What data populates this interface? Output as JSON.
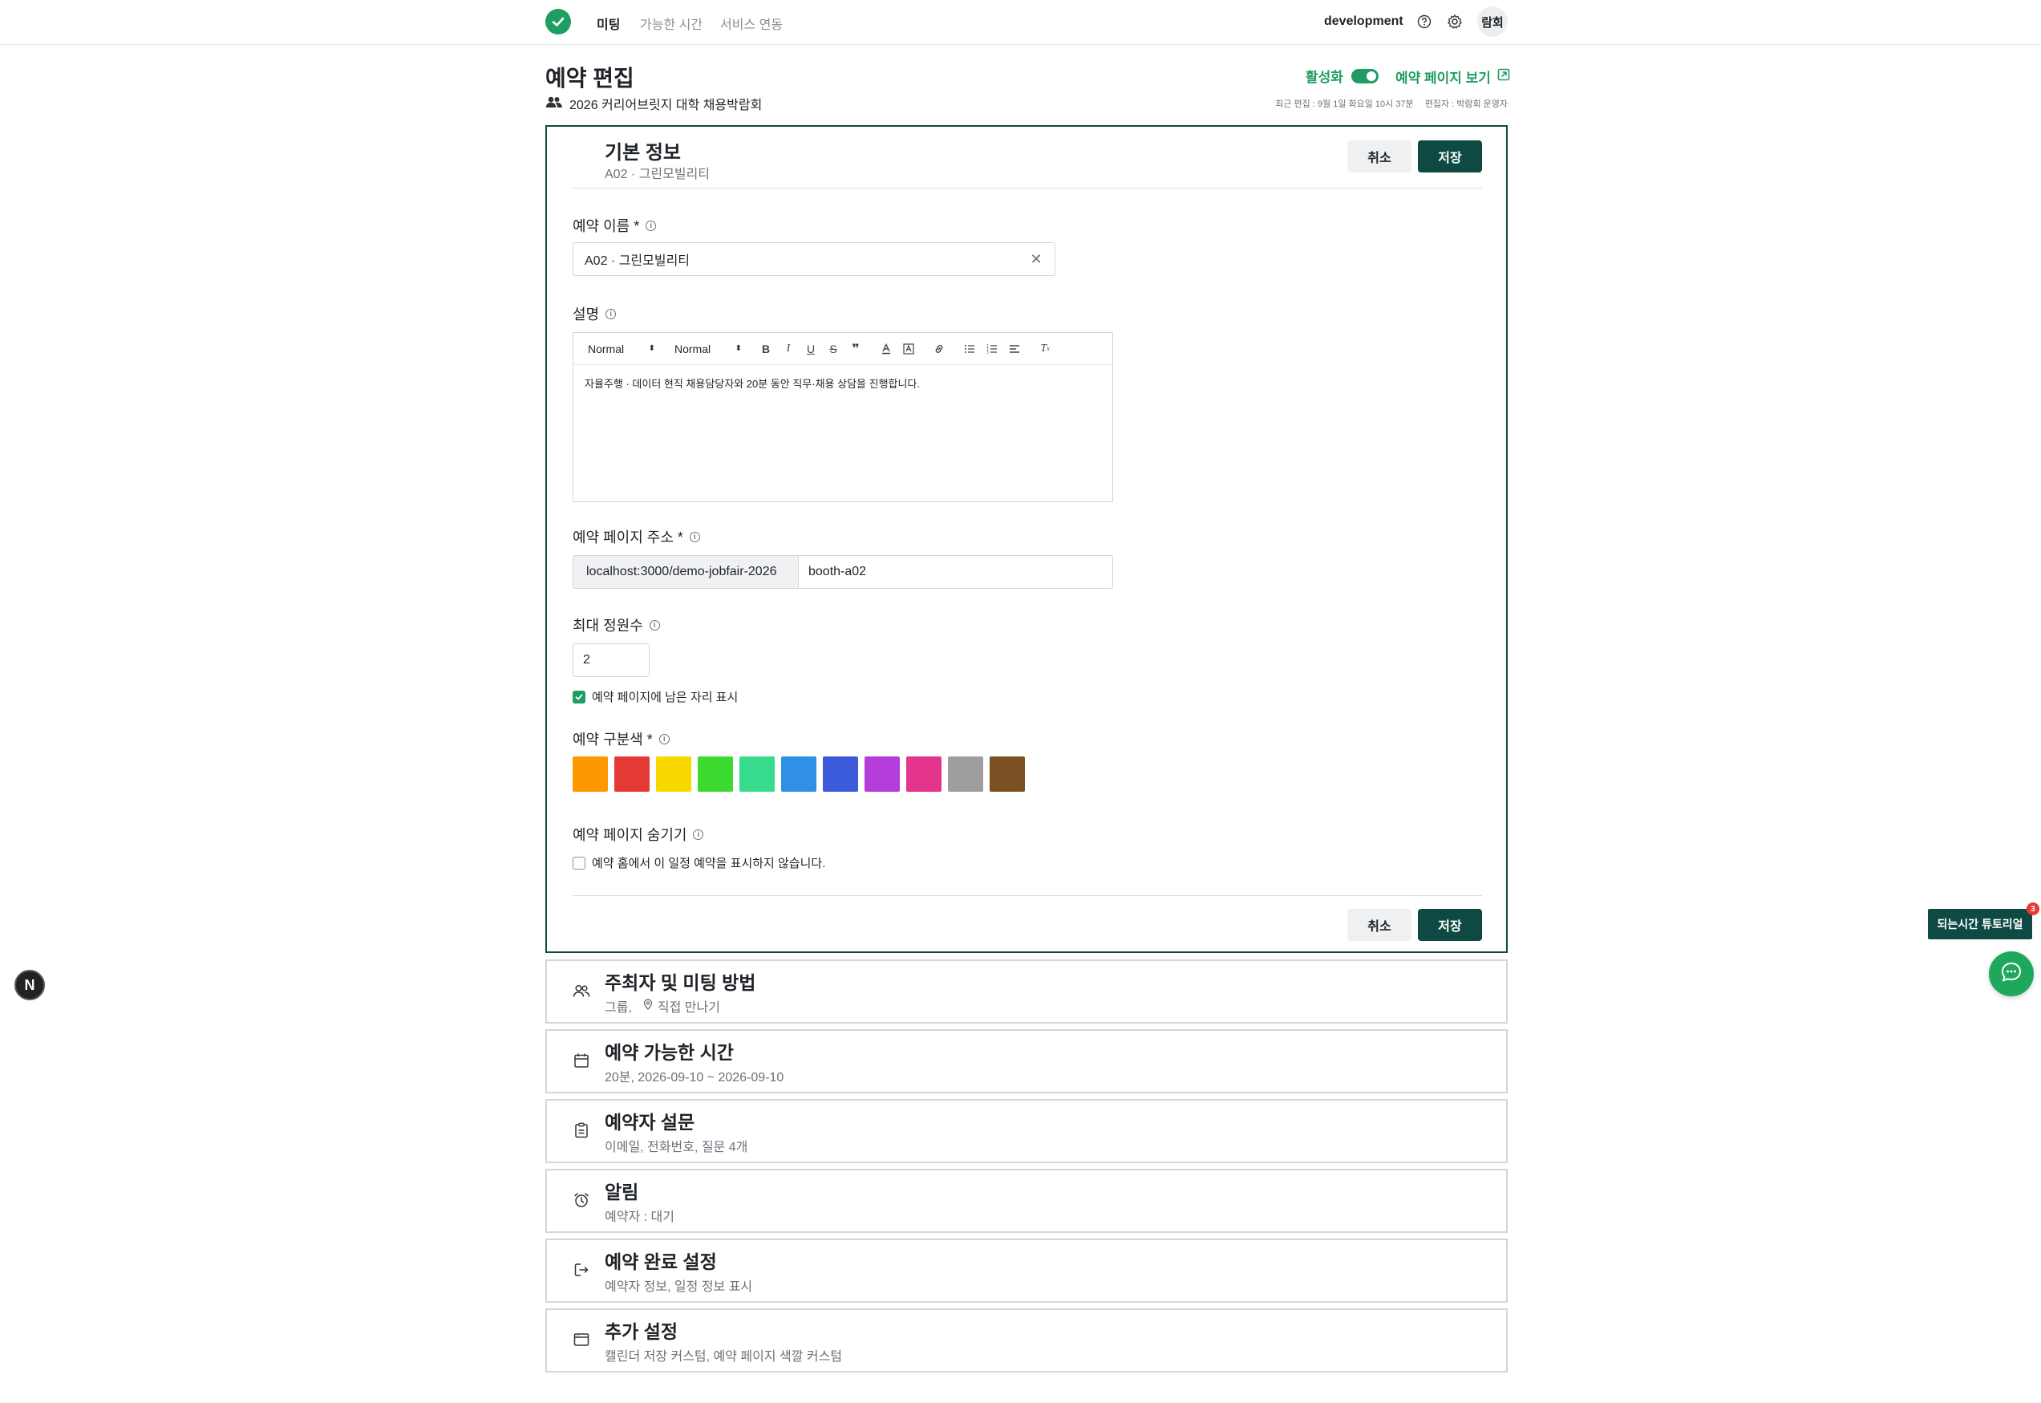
{
  "nav": {
    "items": [
      "미팅",
      "가능한 시간",
      "서비스 연동"
    ],
    "env_label": "development",
    "avatar_text": "람회"
  },
  "header": {
    "title": "예약 편집",
    "group_name": "2026 커리어브릿지 대학 채용박람회",
    "active_label": "활성화",
    "view_page_label": "예약 페이지 보기",
    "last_edited": "최근 편집 : 9월 1일 화요일 10시 37분",
    "editor": "편집자 : 박람회 운영자"
  },
  "basic_info": {
    "title": "기본 정보",
    "subtitle": "A02 · 그린모빌리티",
    "cancel_label": "취소",
    "save_label": "저장",
    "name_label": "예약 이름 *",
    "name_value": "A02 · 그린모빌리티",
    "description_label": "설명",
    "toolbar_font": "Normal",
    "toolbar_size": "Normal",
    "description_text": "자율주행 · 데이터 현직 채용담당자와 20분 동안 직무·채용 상담을 진행합니다.",
    "url_label": "예약 페이지 주소 *",
    "url_prefix": "localhost:3000/demo-jobfair-2026",
    "url_slug": "booth-a02",
    "capacity_label": "최대 정원수",
    "capacity_value": "2",
    "show_remaining_label": "예약 페이지에 남은 자리 표시",
    "show_remaining_checked": true,
    "color_label": "예약 구분색 *",
    "colors": [
      "#fd9800",
      "#e53935",
      "#f7d900",
      "#3ddb2f",
      "#36dc8c",
      "#2f90e5",
      "#3b5bdb",
      "#b53ddb",
      "#e4358d",
      "#9e9e9e",
      "#7a4f22"
    ],
    "hide_label": "예약 페이지 숨기기",
    "hide_checkbox_label": "예약 홈에서 이 일정 예약을 표시하지 않습니다.",
    "hide_checked": false
  },
  "sections": [
    {
      "title": "주최자 및 미팅 방법",
      "summary_a": "그룹,",
      "summary_b": "직접 만나기",
      "icon": "people-icon"
    },
    {
      "title": "예약 가능한 시간",
      "summary": "20분,  2026-09-10 ~ 2026-09-10",
      "icon": "calendar-icon"
    },
    {
      "title": "예약자 설문",
      "summary": "이메일, 전화번호, 질문 4개",
      "icon": "form-icon"
    },
    {
      "title": "알림",
      "summary": "예약자 : 대기",
      "icon": "alarm-icon"
    },
    {
      "title": "예약 완료 설정",
      "summary": "예약자 정보, 일정 정보 표시",
      "icon": "exit-icon"
    },
    {
      "title": "추가 설정",
      "summary": "캘린더 저장 커스텀, 예약 페이지 색깔 커스텀",
      "icon": "window-icon"
    }
  ],
  "floating": {
    "next_badge": "N",
    "tutorial_label": "되는시간 튜토리얼",
    "tutorial_count": "3"
  },
  "theme": {
    "primary": "#0e4a43",
    "accent": "#1f9d63"
  }
}
